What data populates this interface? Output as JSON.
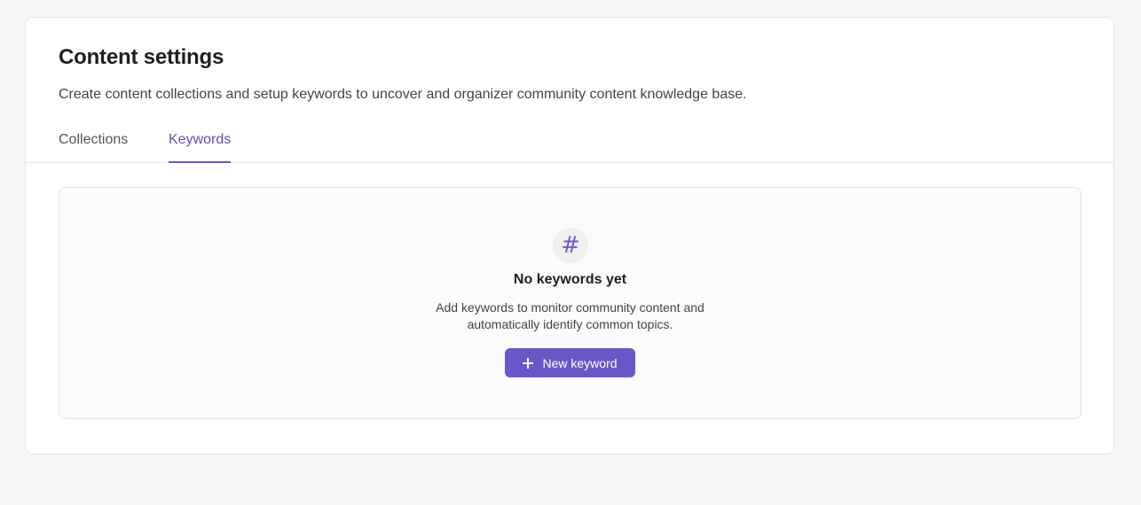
{
  "header": {
    "title": "Content settings",
    "description": "Create content collections and setup keywords to uncover and organizer community content knowledge base."
  },
  "tabs": [
    {
      "label": "Collections",
      "active": false
    },
    {
      "label": "Keywords",
      "active": true
    }
  ],
  "empty_state": {
    "icon": "hash-icon",
    "icon_glyph": "#",
    "title": "No keywords yet",
    "description_line1": "Add keywords to monitor community content and",
    "description_line2": "automatically identify common topics.",
    "button_label": "New keyword"
  },
  "colors": {
    "accent": "#6a57c7",
    "background": "#f7f7f7"
  }
}
